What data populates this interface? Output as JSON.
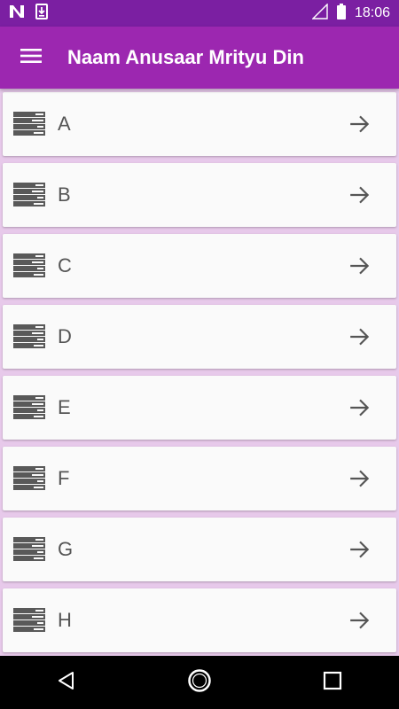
{
  "status_bar": {
    "time": "18:06",
    "icons": [
      "n-notification-icon",
      "download-icon",
      "signal-icon",
      "battery-icon"
    ]
  },
  "app_bar": {
    "title": "Naam Anusaar Mrityu Din",
    "menu_icon": "hamburger-menu-icon",
    "color": "#9c27b0"
  },
  "list": {
    "items": [
      {
        "label": "A"
      },
      {
        "label": "B"
      },
      {
        "label": "C"
      },
      {
        "label": "D"
      },
      {
        "label": "E"
      },
      {
        "label": "F"
      },
      {
        "label": "G"
      },
      {
        "label": "H"
      }
    ],
    "item_icon": "list-icon",
    "arrow_icon": "arrow-right-icon"
  },
  "nav_bar": {
    "icons": [
      "back-icon",
      "home-icon",
      "recents-icon"
    ]
  },
  "colors": {
    "status_bar": "#7b1fa2",
    "app_bar": "#9c27b0",
    "background": "#e7c9ea",
    "card": "#fafafa"
  }
}
